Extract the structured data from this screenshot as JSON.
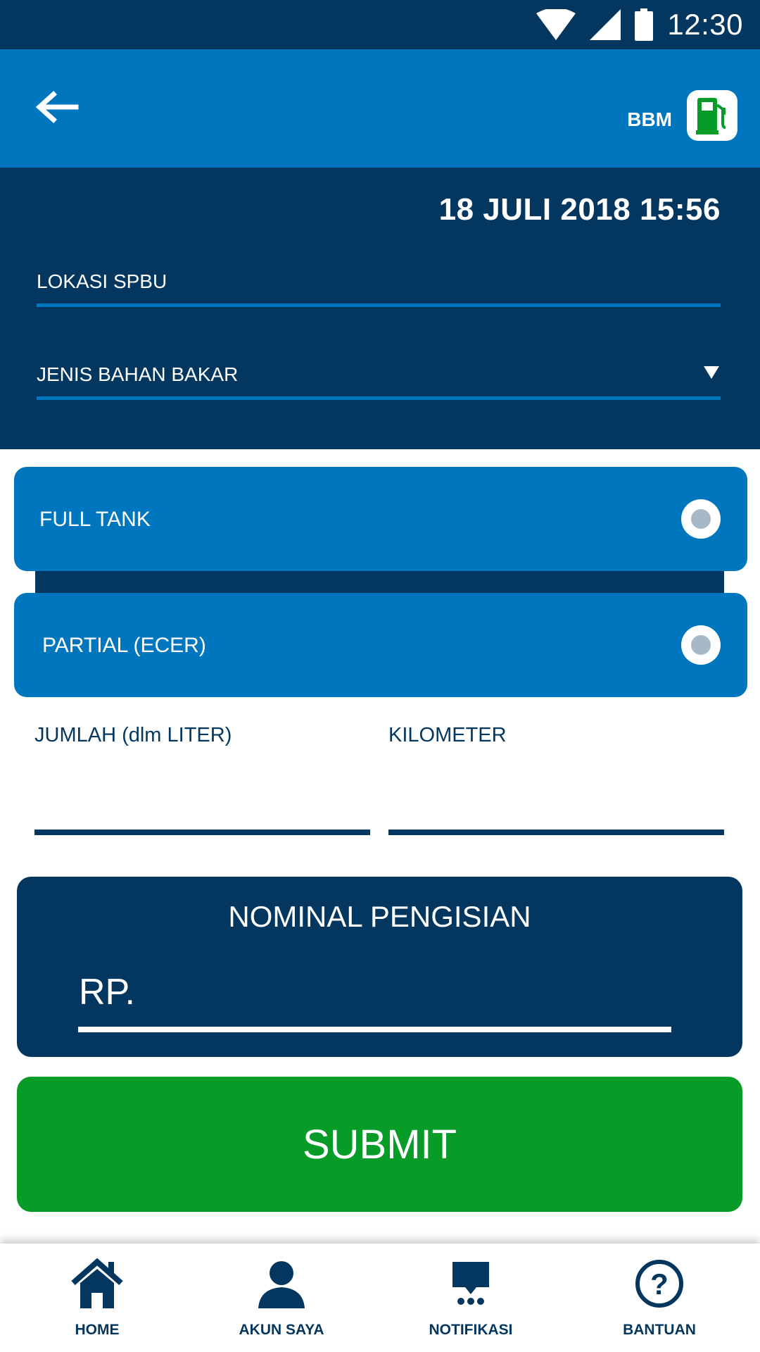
{
  "status_bar": {
    "time": "12:30"
  },
  "app_bar": {
    "title": "BBM",
    "back_icon": "back-arrow-icon",
    "badge_icon": "fuel-pump-icon"
  },
  "form": {
    "datetime": "18 JULI 2018 15:56",
    "lokasi_label": "LOKASI SPBU",
    "jenis_label": "JENIS BAHAN BAKAR"
  },
  "options": [
    {
      "label": "FULL TANK",
      "selected": false
    },
    {
      "label": "PARTIAL (ECER)",
      "selected": false
    }
  ],
  "inputs": {
    "jumlah_label": "JUMLAH (dlm LITER)",
    "kilometer_label": "KILOMETER"
  },
  "nominal": {
    "title": "NOMINAL PENGISIAN",
    "prefix": "RP."
  },
  "submit_label": "SUBMIT",
  "bottom_nav": [
    {
      "label": "HOME",
      "icon": "home-icon"
    },
    {
      "label": "AKUN SAYA",
      "icon": "user-icon"
    },
    {
      "label": "NOTIFIKASI",
      "icon": "chat-bubble-icon"
    },
    {
      "label": "BANTUAN",
      "icon": "help-icon"
    }
  ],
  "colors": {
    "navy": "#03375f",
    "blue": "#0076be",
    "green": "#079c27",
    "radio_dot": "#a6b7c5"
  }
}
